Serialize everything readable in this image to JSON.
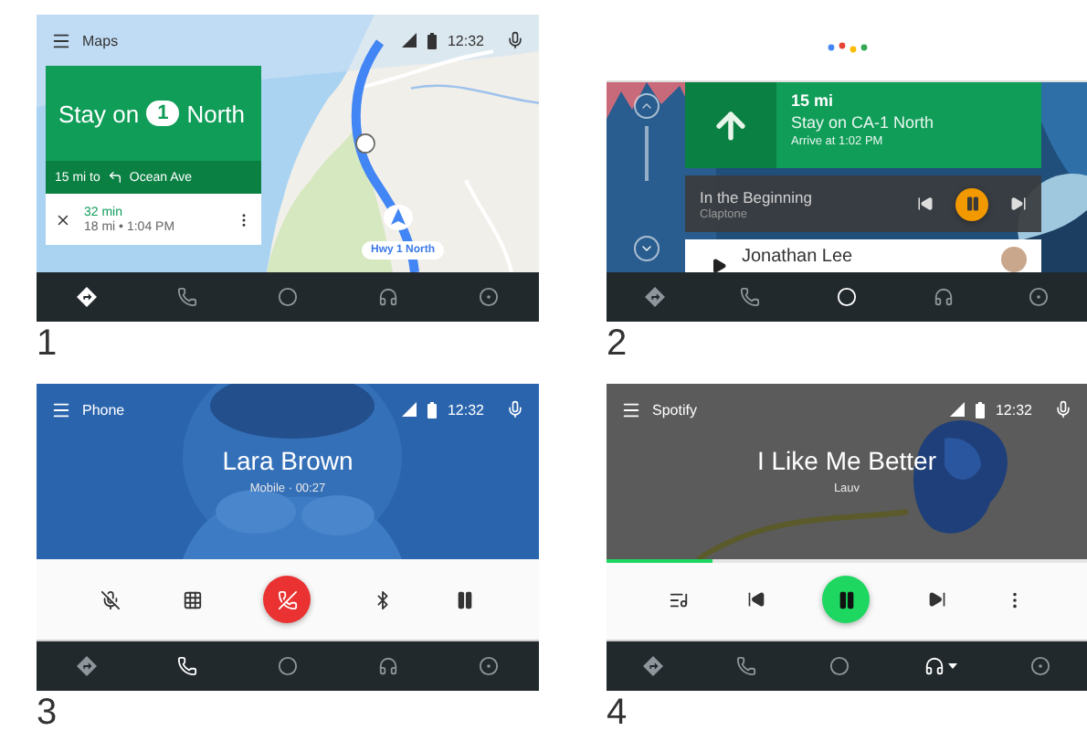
{
  "screens": [
    {
      "kind": "maps",
      "number": "1",
      "header": {
        "app": "Maps",
        "time": "12:32"
      },
      "direction": {
        "before": "Stay on",
        "route": "1",
        "after": "North"
      },
      "next_turn": {
        "distance": "15 mi to",
        "street": "Ocean Ave"
      },
      "trip": {
        "duration": "32 min",
        "details": "18 mi • 1:04 PM"
      },
      "location_label": "Hwy 1 North",
      "nav": [
        {
          "kind": "navigation",
          "selected": true,
          "caret": false
        },
        {
          "kind": "phone",
          "selected": false,
          "caret": false
        },
        {
          "kind": "home",
          "selected": false,
          "caret": false
        },
        {
          "kind": "music",
          "selected": false,
          "caret": false
        },
        {
          "kind": "exit",
          "selected": false,
          "caret": false
        }
      ]
    },
    {
      "kind": "overview",
      "number": "2",
      "route_card": {
        "distance": "15 mi",
        "instruction": "Stay on CA-1 North",
        "arrival": "Arrive at 1:02 PM"
      },
      "media_card": {
        "title": "In the Beginning",
        "artist": "Claptone"
      },
      "contact_card": {
        "name": "Jonathan Lee"
      },
      "nav": [
        {
          "kind": "navigation",
          "selected": false,
          "caret": false
        },
        {
          "kind": "phone",
          "selected": false,
          "caret": false
        },
        {
          "kind": "home",
          "selected": true,
          "caret": false
        },
        {
          "kind": "music",
          "selected": false,
          "caret": false
        },
        {
          "kind": "exit",
          "selected": false,
          "caret": false
        }
      ]
    },
    {
      "kind": "call",
      "number": "3",
      "header": {
        "app": "Phone",
        "time": "12:32"
      },
      "caller": "Lara Brown",
      "line": "Mobile · 00:27",
      "controls": [
        {
          "kind": "mute"
        },
        {
          "kind": "dialpad"
        },
        {
          "kind": "end_call"
        },
        {
          "kind": "bluetooth"
        },
        {
          "kind": "hold"
        }
      ],
      "nav": [
        {
          "kind": "navigation",
          "selected": false,
          "caret": false
        },
        {
          "kind": "phone",
          "selected": true,
          "caret": false
        },
        {
          "kind": "home",
          "selected": false,
          "caret": false
        },
        {
          "kind": "music",
          "selected": false,
          "caret": false
        },
        {
          "kind": "exit",
          "selected": false,
          "caret": false
        }
      ]
    },
    {
      "kind": "player",
      "number": "4",
      "header": {
        "app": "Spotify",
        "time": "12:32"
      },
      "song": "I Like Me Better",
      "artist": "Lauv",
      "progress": {
        "level": 0.22
      },
      "controls": [
        {
          "kind": "queue"
        },
        {
          "kind": "previous"
        },
        {
          "kind": "pause"
        },
        {
          "kind": "next"
        },
        {
          "kind": "more"
        }
      ],
      "nav": [
        {
          "kind": "navigation",
          "selected": false,
          "caret": false
        },
        {
          "kind": "phone",
          "selected": false,
          "caret": false
        },
        {
          "kind": "home",
          "selected": false,
          "caret": false
        },
        {
          "kind": "music",
          "selected": true,
          "caret": true
        },
        {
          "kind": "exit",
          "selected": false,
          "caret": false
        }
      ]
    }
  ]
}
